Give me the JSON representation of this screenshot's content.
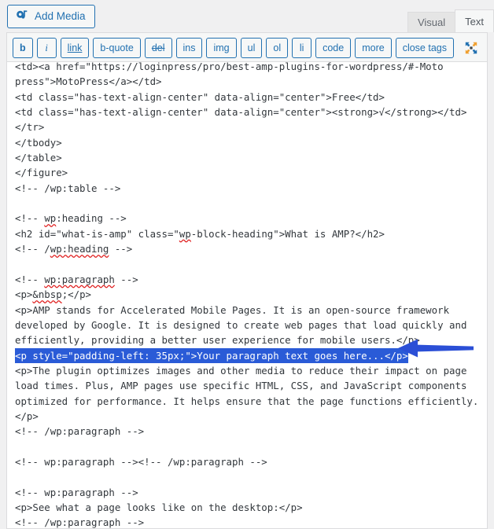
{
  "window": {
    "background": "#f0f0f1",
    "accent_blue": "#2271b1",
    "selection_blue": "#2a5bd7",
    "arrow_color": "#2b4fd6"
  },
  "toolbar": {
    "add_media_label": "Add Media",
    "add_media_icon": "media-icon",
    "fullscreen_icon": "fullscreen-expand-icon"
  },
  "tabs": [
    {
      "label": "Visual",
      "active": false
    },
    {
      "label": "Text",
      "active": true
    }
  ],
  "quicktags": [
    {
      "label": "b",
      "style": "style-bold",
      "name": "bold"
    },
    {
      "label": "i",
      "style": "style-italic",
      "name": "italic"
    },
    {
      "label": "link",
      "style": "style-underline",
      "name": "link"
    },
    {
      "label": "b-quote",
      "style": "",
      "name": "b-quote"
    },
    {
      "label": "del",
      "style": "style-strike",
      "name": "del"
    },
    {
      "label": "ins",
      "style": "",
      "name": "ins"
    },
    {
      "label": "img",
      "style": "",
      "name": "img"
    },
    {
      "label": "ul",
      "style": "",
      "name": "ul"
    },
    {
      "label": "ol",
      "style": "",
      "name": "ol"
    },
    {
      "label": "li",
      "style": "",
      "name": "li"
    },
    {
      "label": "code",
      "style": "",
      "name": "code"
    },
    {
      "label": "more",
      "style": "",
      "name": "more"
    },
    {
      "label": "close tags",
      "style": "",
      "name": "close-tags"
    }
  ],
  "editor": {
    "mode": "Text",
    "lines": [
      {
        "text": "<td><a href=\"https://loginpress/pro/best-amp-plugins-for-wordpress/#-Moto",
        "clipped_top": true
      },
      {
        "text": "press\">MotoPress</a></td>"
      },
      {
        "text": "<td class=\"has-text-align-center\" data-align=\"center\">Free</td>"
      },
      {
        "text": "<td class=\"has-text-align-center\" data-align=\"center\"><strong>√</strong></td>"
      },
      {
        "text": "</tr>"
      },
      {
        "text": "</tbody>"
      },
      {
        "text": "</table>"
      },
      {
        "text": "</figure>"
      },
      {
        "text": "<!-- /wp:table -->"
      },
      {
        "text": ""
      },
      {
        "text": "<!-- wp:heading -->",
        "spell": [
          "wp"
        ]
      },
      {
        "text": "<h2 id=\"what-is-amp\" class=\"wp-block-heading\">What is AMP?</h2>",
        "spell": [
          "wp"
        ]
      },
      {
        "text": "<!-- /wp:heading -->",
        "spell": [
          "wp:heading"
        ]
      },
      {
        "text": ""
      },
      {
        "text": "<!-- wp:paragraph -->",
        "spell": [
          "wp:paragraph"
        ]
      },
      {
        "text": "<p>&nbsp;</p>",
        "spell": [
          "&nbsp"
        ]
      },
      {
        "text": "<p>AMP stands for Accelerated Mobile Pages. It is an open-source framework developed by Google. It is designed to create web pages that load quickly and efficiently, providing a better user experience for mobile users.</p>"
      },
      {
        "text": "<p style=\"padding-left: 35px;\">Your paragraph text goes here...</p>",
        "selected": true
      },
      {
        "text": "<p>The plugin optimizes images and other media to reduce their impact on page load times. Plus, AMP pages use specific HTML, CSS, and JavaScript components optimized for performance. It helps ensure that the page functions efficiently.</p>"
      },
      {
        "text": "<!-- /wp:paragraph -->"
      },
      {
        "text": ""
      },
      {
        "text": "<!-- wp:paragraph --><!-- /wp:paragraph -->"
      },
      {
        "text": ""
      },
      {
        "text": "<!-- wp:paragraph -->"
      },
      {
        "text": "<p>See what a page looks like on the desktop:</p>"
      },
      {
        "text": "<!-- /wp:paragraph -->"
      }
    ]
  },
  "annotation": {
    "type": "arrow",
    "direction": "left",
    "points_to": "<p style=\"padding-left: 35px;\">Your paragraph text goes here...</p>",
    "color": "#2b4fd6"
  }
}
